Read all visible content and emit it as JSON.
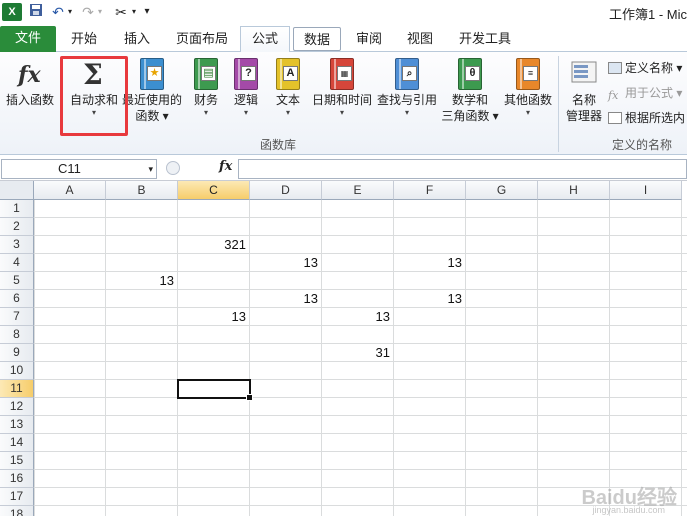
{
  "titlebar": {
    "title": "工作簿1 - Mic"
  },
  "tabs": {
    "file": "文件",
    "items": [
      "开始",
      "插入",
      "页面布局",
      "公式",
      "数据",
      "审阅",
      "视图",
      "开发工具"
    ]
  },
  "ribbon": {
    "insert_function": "插入函数",
    "autosum": "自动求和",
    "recent_line1": "最近使用的",
    "recent_line2": "函数",
    "financial": "财务",
    "logical": "逻辑",
    "text": "文本",
    "datetime": "日期和时间",
    "lookup": "查找与引用",
    "math_line1": "数学和",
    "math_line2": "三角函数",
    "other": "其他函数",
    "group_library": "函数库",
    "name_mgr_line1": "名称",
    "name_mgr_line2": "管理器",
    "define_name": "定义名称",
    "use_in_formula": "用于公式",
    "create_from_sel": "根据所选内",
    "group_names": "定义的名称"
  },
  "formula_bar": {
    "name_box": "C11",
    "fx": "fx",
    "formula": ""
  },
  "grid": {
    "columns": [
      "A",
      "B",
      "C",
      "D",
      "E",
      "F",
      "G",
      "H",
      "I"
    ],
    "rows": [
      "1",
      "2",
      "3",
      "4",
      "5",
      "6",
      "7",
      "8",
      "9",
      "10",
      "11",
      "12",
      "13",
      "14",
      "15",
      "16",
      "17",
      "18"
    ],
    "selected_col": "C",
    "selected_row": "11",
    "cells": {
      "C3": "321",
      "D4": "13",
      "F4": "13",
      "B5": "13",
      "D6": "13",
      "F6": "13",
      "C7": "13",
      "E7": "13",
      "E9": "31"
    }
  },
  "watermark": {
    "brand": "Baidu经验",
    "url": "jingyan.baidu.com"
  },
  "colors": {
    "file_tab": "#2a8c3a",
    "highlight": "#e8393d",
    "selection": "#f6cd6b"
  }
}
